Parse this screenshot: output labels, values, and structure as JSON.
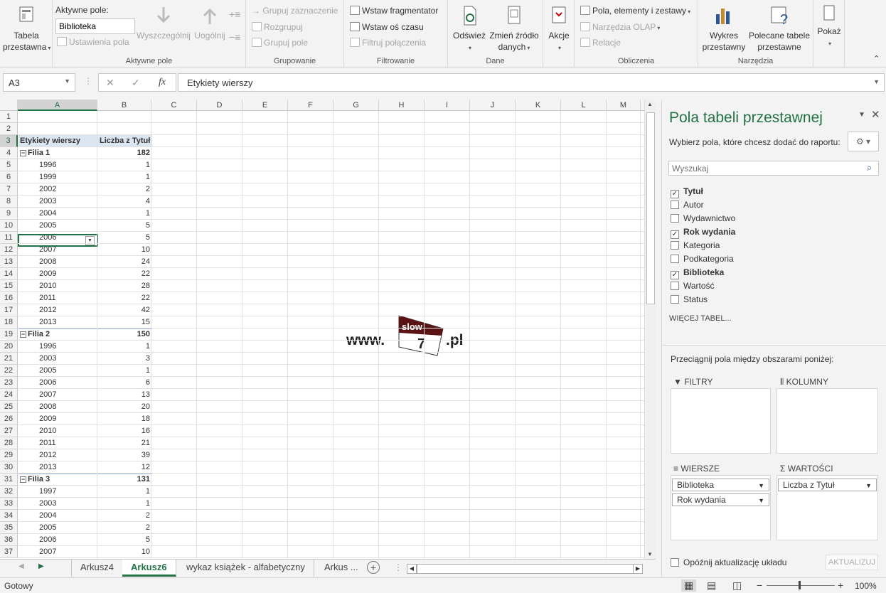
{
  "ribbon": {
    "pivot_table": {
      "label": "Tabela",
      "label2": "przestawna"
    },
    "active_field": {
      "label": "Aktywne pole:",
      "value": "Biblioteka",
      "field_settings": "Ustawienia pola",
      "drill_down": "Wyszczególnij",
      "drill_up": "Uogólnij",
      "group_label": "Aktywne pole"
    },
    "grouping": {
      "group_selection": "Grupuj zaznaczenie",
      "ungroup": "Rozgrupuj",
      "group_field": "Grupuj pole",
      "group_label": "Grupowanie"
    },
    "filter": {
      "insert_slicer": "Wstaw fragmentator",
      "insert_timeline": "Wstaw oś czasu",
      "filter_connections": "Filtruj połączenia",
      "group_label": "Filtrowanie"
    },
    "data": {
      "refresh": "Odśwież",
      "change_source": "Zmień źródło",
      "change_source2": "danych",
      "group_label": "Dane"
    },
    "actions": {
      "label": "Akcje"
    },
    "calculations": {
      "fields_items": "Pola, elementy i zestawy",
      "olap_tools": "Narzędzia OLAP",
      "relationships": "Relacje",
      "group_label": "Obliczenia"
    },
    "tools": {
      "pivot_chart": "Wykres",
      "pivot_chart2": "przestawny",
      "recommended": "Polecane tabele",
      "recommended2": "przestawne",
      "group_label": "Narzędzia"
    },
    "show": {
      "label": "Pokaż"
    }
  },
  "formula_bar": {
    "name_box": "A3",
    "fx": "fx",
    "formula": "Etykiety wierszy"
  },
  "columns": [
    "A",
    "B",
    "C",
    "D",
    "E",
    "F",
    "G",
    "H",
    "I",
    "J",
    "K",
    "L",
    "M"
  ],
  "rows": [
    "1",
    "2",
    "3",
    "4",
    "5",
    "6",
    "7",
    "8",
    "9",
    "10",
    "11",
    "12",
    "13",
    "14",
    "15",
    "16",
    "17",
    "18",
    "19",
    "20",
    "21",
    "22",
    "23",
    "24",
    "25",
    "26",
    "27",
    "28",
    "29",
    "30",
    "31",
    "32",
    "33",
    "34",
    "35",
    "36",
    "37"
  ],
  "pivot": {
    "header_rows": "Etykiety wierszy",
    "header_values": "Liczba z Tytuł",
    "entries": [
      {
        "a": "Filia 1",
        "b": "182",
        "group": true
      },
      {
        "a": "1996",
        "b": "1"
      },
      {
        "a": "1999",
        "b": "1"
      },
      {
        "a": "2002",
        "b": "2"
      },
      {
        "a": "2003",
        "b": "4"
      },
      {
        "a": "2004",
        "b": "1"
      },
      {
        "a": "2005",
        "b": "5"
      },
      {
        "a": "2006",
        "b": "5"
      },
      {
        "a": "2007",
        "b": "10"
      },
      {
        "a": "2008",
        "b": "24"
      },
      {
        "a": "2009",
        "b": "22"
      },
      {
        "a": "2010",
        "b": "28"
      },
      {
        "a": "2011",
        "b": "22"
      },
      {
        "a": "2012",
        "b": "42"
      },
      {
        "a": "2013",
        "b": "15"
      },
      {
        "a": "Filia 2",
        "b": "150",
        "group": true
      },
      {
        "a": "1996",
        "b": "1"
      },
      {
        "a": "2003",
        "b": "3"
      },
      {
        "a": "2005",
        "b": "1"
      },
      {
        "a": "2006",
        "b": "6"
      },
      {
        "a": "2007",
        "b": "13"
      },
      {
        "a": "2008",
        "b": "20"
      },
      {
        "a": "2009",
        "b": "18"
      },
      {
        "a": "2010",
        "b": "16"
      },
      {
        "a": "2011",
        "b": "21"
      },
      {
        "a": "2012",
        "b": "39"
      },
      {
        "a": "2013",
        "b": "12"
      },
      {
        "a": "Filia 3",
        "b": "131",
        "group": true
      },
      {
        "a": "1997",
        "b": "1"
      },
      {
        "a": "2003",
        "b": "1"
      },
      {
        "a": "2004",
        "b": "2"
      },
      {
        "a": "2005",
        "b": "2"
      },
      {
        "a": "2006",
        "b": "5"
      },
      {
        "a": "2007",
        "b": "10"
      }
    ]
  },
  "watermark": {
    "prefix": "www.",
    "brand_top": "slow",
    "brand_num": "7",
    "suffix": ".pl"
  },
  "sheet_tabs": {
    "tabs": [
      "Arkusz4",
      "Arkusz6",
      "wykaz książek - alfabetyczny",
      "Arkus ..."
    ],
    "active": "Arkusz6"
  },
  "status": {
    "ready": "Gotowy",
    "zoom": "100%"
  },
  "pane": {
    "title": "Pola tabeli przestawnej",
    "subtitle": "Wybierz pola, które chcesz dodać do raportu:",
    "search_placeholder": "Wyszukaj",
    "fields": [
      {
        "name": "Tytuł",
        "checked": true
      },
      {
        "name": "Autor",
        "checked": false
      },
      {
        "name": "Wydawnictwo",
        "checked": false
      },
      {
        "name": "Rok wydania",
        "checked": true
      },
      {
        "name": "Kategoria",
        "checked": false
      },
      {
        "name": "Podkategoria",
        "checked": false
      },
      {
        "name": "Biblioteka",
        "checked": true
      },
      {
        "name": "Wartość",
        "checked": false
      },
      {
        "name": "Status",
        "checked": false
      }
    ],
    "more_tables": "WIĘCEJ TABEL...",
    "drag_hint": "Przeciągnij pola między obszarami poniżej:",
    "areas": {
      "filters": "FILTRY",
      "columns": "KOLUMNY",
      "rows": "WIERSZE",
      "values": "WARTOŚCI"
    },
    "rows_items": [
      "Biblioteka",
      "Rok wydania"
    ],
    "values_items": [
      "Liczba z Tytuł"
    ],
    "defer": "Opóźnij aktualizację układu",
    "update": "AKTUALIZUJ"
  },
  "colors": {
    "accent": "#217346",
    "header_fill": "#dce6f1"
  }
}
